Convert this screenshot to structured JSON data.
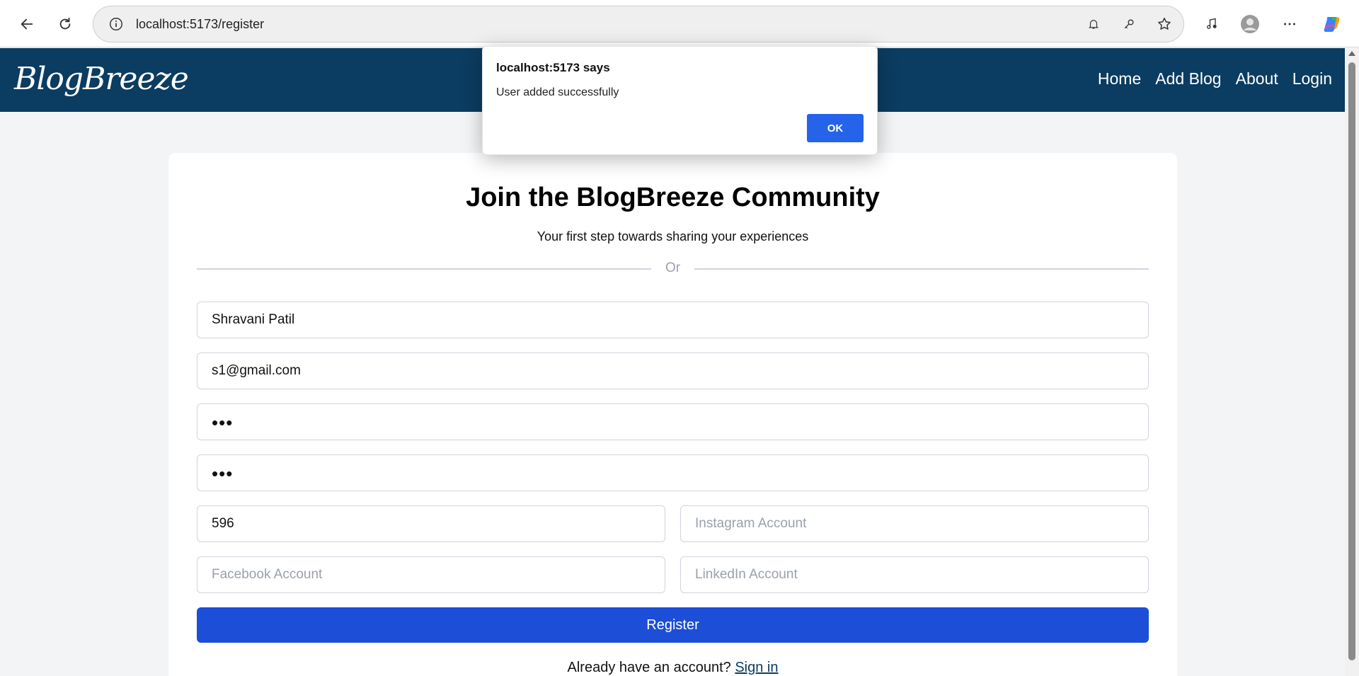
{
  "browser": {
    "url": "localhost:5173/register",
    "icons": [
      "back-arrow-icon",
      "reload-icon",
      "info-icon",
      "notification-bell-icon",
      "key-icon",
      "star-icon",
      "media-icon",
      "profile-avatar-icon",
      "more-options-icon",
      "copilot-icon"
    ]
  },
  "navbar": {
    "logo": "BlogBreeze",
    "links": [
      "Home",
      "Add Blog",
      "About",
      "Login"
    ],
    "bg_color": "#0b3c61"
  },
  "form": {
    "title": "Join the BlogBreeze Community",
    "subtitle": "Your first step towards sharing your experiences",
    "divider_text": "Or",
    "name_value": "Shravani Patil",
    "email_value": "s1@gmail.com",
    "password_mask": "•••",
    "confirm_password_mask": "•••",
    "phone_value": "596",
    "instagram_placeholder": "Instagram Account",
    "facebook_placeholder": "Facebook Account",
    "linkedin_placeholder": "LinkedIn Account",
    "register_label": "Register",
    "signin_prompt": "Already have an account?",
    "signin_link": "Sign in",
    "button_color": "#1d4ed8"
  },
  "dialog": {
    "title": "localhost:5173 says",
    "message": "User added successfully",
    "ok_label": "OK"
  }
}
